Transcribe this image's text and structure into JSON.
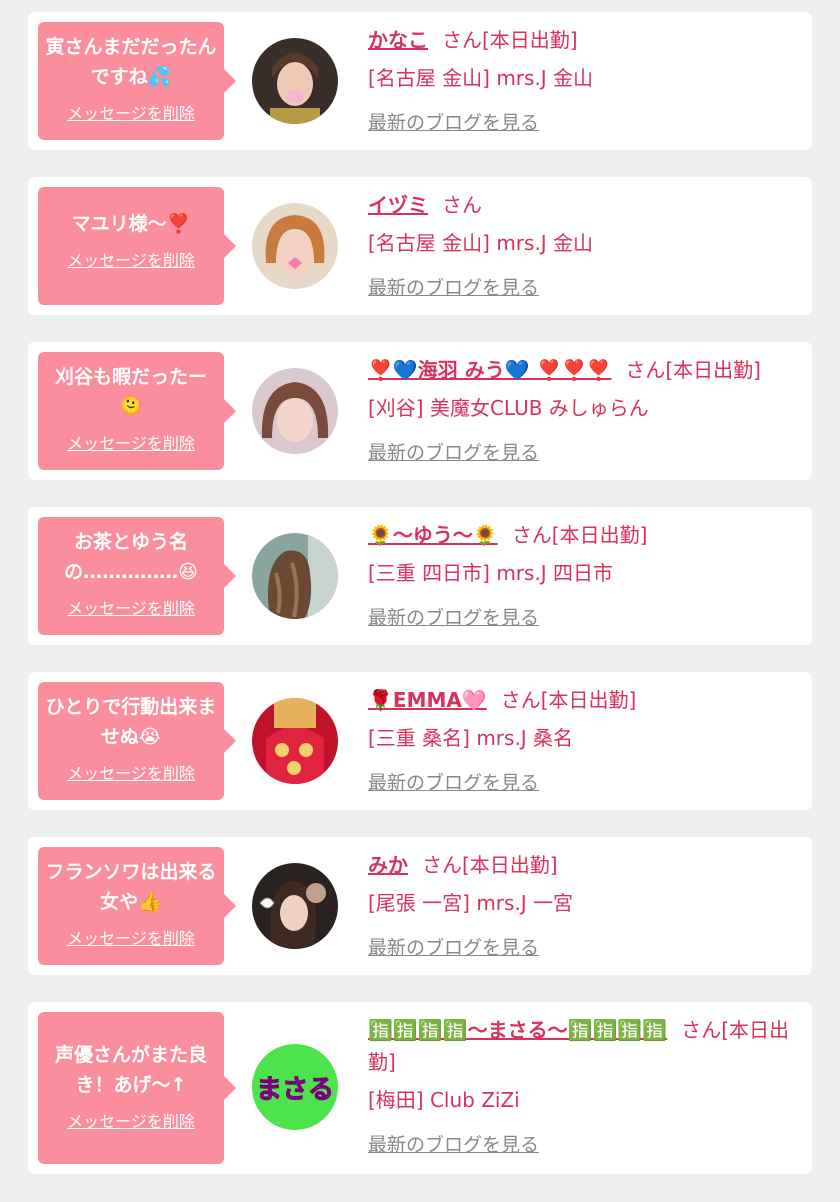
{
  "delete_label": "メッセージを削除",
  "blog_label": "最新のブログを見る",
  "colors": {
    "bubble": "#fa8e9c",
    "accent": "#d8315b",
    "card": "#ffffff",
    "background": "#efefef",
    "link_gray": "#888888"
  },
  "entries": [
    {
      "message": "寅さんまだだったんですね💦",
      "name": "かなこ",
      "suffix": "さん[本日出勤]",
      "shop": "[名古屋 金山] mrs.J 金山",
      "avatar": "woman-photo-avatar"
    },
    {
      "message": "マユリ様〜❣️",
      "name": "イヅミ",
      "suffix": "さん",
      "shop": "[名古屋 金山] mrs.J 金山",
      "avatar": "woman-photo-avatar"
    },
    {
      "message": "刈谷も暇だったー🫠",
      "name": "❣️💙海羽 みう💙 ❣️❣️❣️",
      "suffix": "さん[本日出勤]",
      "shop": "[刈谷] 美魔女CLUB みしゅらん",
      "avatar": "woman-photo-avatar"
    },
    {
      "message": "お茶とゆう名の……………😆",
      "name": "🌻〜ゆう〜🌻",
      "suffix": "さん[本日出勤]",
      "shop": "[三重 四日市] mrs.J 四日市",
      "avatar": "woman-hair-photo-avatar"
    },
    {
      "message": "ひとりで行動出来ませぬ😭",
      "name": "🌹EMMA🩷",
      "suffix": "さん[本日出勤]",
      "shop": "[三重 桑名] mrs.J 桑名",
      "avatar": "red-shirt-photo-avatar"
    },
    {
      "message": "フランソワは出来る女や👍",
      "name": "みか",
      "suffix": "さん[本日出勤]",
      "shop": "[尾張 一宮] mrs.J 一宮",
      "avatar": "woman-photo-avatar"
    },
    {
      "message": "声優さんがまた良き！あげ〜↑",
      "name": "🈯🈯🈯🈯〜まさる〜🈯🈯🈯🈯",
      "suffix": "さん[本日出勤]",
      "shop": "[梅田] Club ZiZi",
      "avatar": "text-logo-avatar",
      "avatar_text": "まさる"
    }
  ]
}
